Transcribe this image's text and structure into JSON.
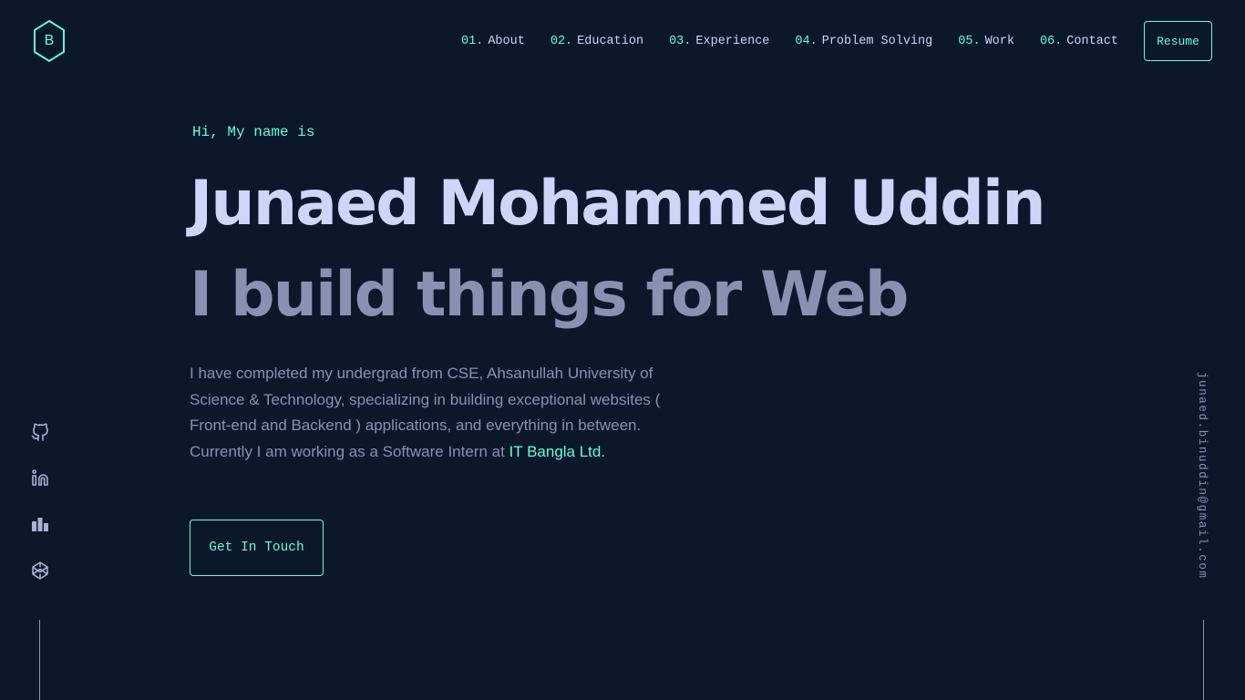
{
  "logo": {
    "letter": "B",
    "icon": "hexagon-logo-icon"
  },
  "nav": {
    "items": [
      {
        "num": "01.",
        "label": "About"
      },
      {
        "num": "02.",
        "label": "Education"
      },
      {
        "num": "03.",
        "label": "Experience"
      },
      {
        "num": "04.",
        "label": "Problem Solving"
      },
      {
        "num": "05.",
        "label": "Work"
      },
      {
        "num": "06.",
        "label": "Contact"
      }
    ],
    "resume_label": "Resume"
  },
  "hero": {
    "greeting": "Hi, My name is",
    "name": "Junaed Mohammed Uddin",
    "tagline": "I build things for Web",
    "bio_text": "I have completed my undergrad from CSE, Ahsanullah University of Science & Technology, specializing in building exceptional websites ( Front-end and Backend ) applications, and everything in between. Currently I am working as a Software Intern at ",
    "bio_highlight": "IT Bangla Ltd.",
    "cta_label": "Get In Touch"
  },
  "social": {
    "icons": [
      "github-icon",
      "linkedin-icon",
      "stats-icon",
      "codepen-icon"
    ]
  },
  "email": "junaed.binuddin@gmail.com",
  "colors": {
    "background": "#0b172b",
    "accent": "#64ffda",
    "light_text": "#ccd6f6",
    "slate_text": "#8892b0"
  }
}
